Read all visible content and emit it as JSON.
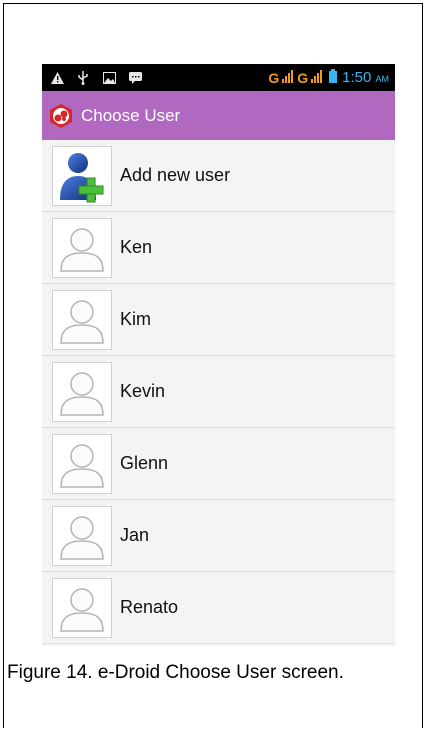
{
  "status_bar": {
    "icons": [
      "warning-icon",
      "usb-icon",
      "image-icon",
      "chat-icon"
    ],
    "network_1": "G",
    "network_2": "G",
    "time": "1:50",
    "ampm": "AM"
  },
  "app_bar": {
    "title": "Choose User",
    "logo_icon": "edroid-logo-icon",
    "color": "#b068c0"
  },
  "users": [
    {
      "label": "Add new user",
      "icon": "add-user-icon"
    },
    {
      "label": "Ken",
      "icon": "user-avatar-icon"
    },
    {
      "label": "Kim",
      "icon": "user-avatar-icon"
    },
    {
      "label": "Kevin",
      "icon": "user-avatar-icon"
    },
    {
      "label": "Glenn",
      "icon": "user-avatar-icon"
    },
    {
      "label": "Jan",
      "icon": "user-avatar-icon"
    },
    {
      "label": "Renato",
      "icon": "user-avatar-icon"
    }
  ],
  "caption": "Figure 14. e-Droid Choose User screen."
}
